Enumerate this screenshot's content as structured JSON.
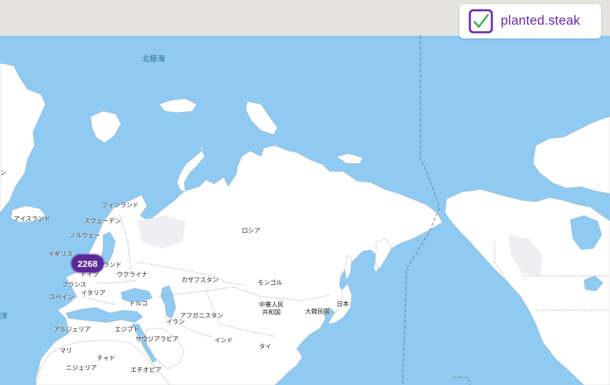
{
  "brand": {
    "name": "planted.steak",
    "logo_icon": "checkbox-check-icon",
    "accent_color": "#6b2ca3",
    "check_color": "#4caf50"
  },
  "map": {
    "water_color": "#8ecaf2",
    "land_color": "#ffffff",
    "sea_labels": {
      "arctic": "北極海",
      "atlantic_fragment": "洋"
    },
    "country_labels": {
      "finland": "フィンランド",
      "iceland": "アイスランド",
      "sweden": "スウェーデン",
      "norway": "ノルウェー",
      "uk": "イギリス",
      "poland": "ランド",
      "germany": "ドイツ",
      "ukraine": "ウクライナ",
      "france": "フランス",
      "italy": "イタリア",
      "spain": "スペイン",
      "russia": "ロシア",
      "kazakhstan": "カザフスタン",
      "mongolia": "モンゴル",
      "china_line1": "中華人民",
      "china_line2": "共和国",
      "japan": "日本",
      "korea": "大韓民国",
      "turkey": "トルコ",
      "afghanistan": "アフガニスタン",
      "iran": "イラン",
      "algeria": "アルジェリア",
      "egypt": "エジプト",
      "saudi": "サウジアラビア",
      "india": "インド",
      "thailand": "タイ",
      "mali": "マリ",
      "chad": "チャド",
      "niger": "ニジェリア",
      "ethiopia": "エチオピア",
      "greenland_fragment": "ン"
    },
    "cluster": {
      "count": "2268",
      "color": "#5b2a97"
    }
  }
}
